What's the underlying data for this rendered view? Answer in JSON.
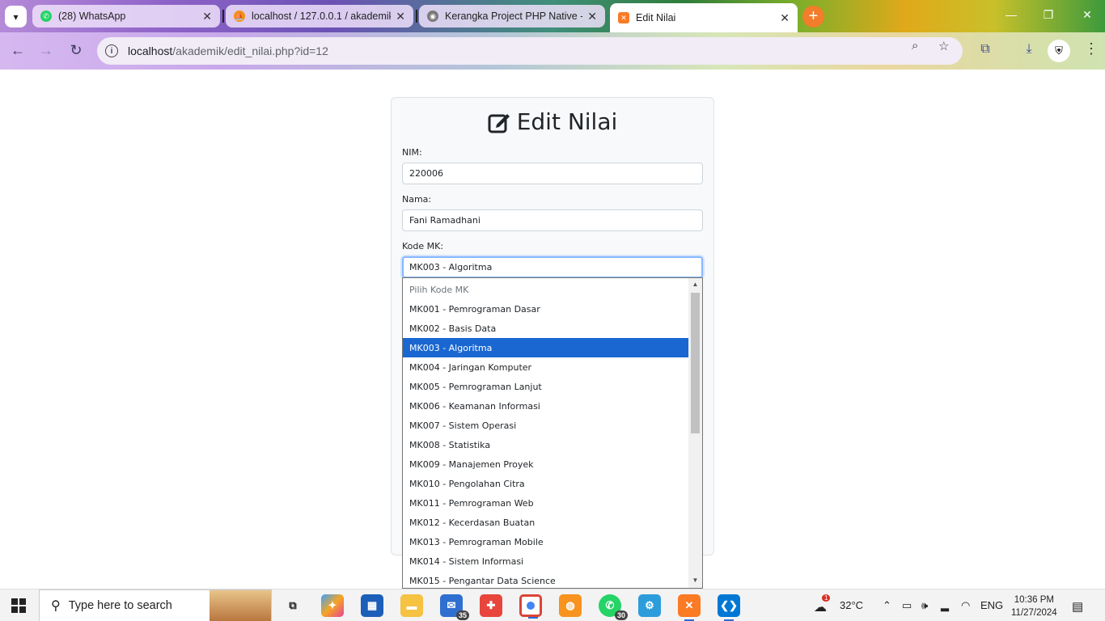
{
  "browser": {
    "tabs": [
      {
        "title": "(28) WhatsApp",
        "icon": "whatsapp-icon",
        "color": "#25d366"
      },
      {
        "title": "localhost / 127.0.0.1 / akademik",
        "icon": "phpmyadmin-icon",
        "color": "#f29111"
      },
      {
        "title": "Kerangka Project PHP Native - ",
        "icon": "chrome-icon",
        "color": "#7a7a7a"
      },
      {
        "title": "Edit Nilai",
        "icon": "xampp-icon",
        "color": "#fb7a24"
      }
    ],
    "url_host": "localhost",
    "url_path": "/akademik/edit_nilai.php?id=12"
  },
  "page": {
    "title": "Edit Nilai",
    "nim_label": "NIM:",
    "nim_value": "220006",
    "nama_label": "Nama:",
    "nama_value": "Fani Ramadhani",
    "kode_mk_label": "Kode MK:",
    "kode_mk_value": "MK003 - Algoritma"
  },
  "dropdown": {
    "placeholder": "Pilih Kode MK",
    "options": [
      "MK001 - Pemrograman Dasar",
      "MK002 - Basis Data",
      "MK003 - Algoritma",
      "MK004 - Jaringan Komputer",
      "MK005 - Pemrograman Lanjut",
      "MK006 - Keamanan Informasi",
      "MK007 - Sistem Operasi",
      "MK008 - Statistika",
      "MK009 - Manajemen Proyek",
      "MK010 - Pengolahan Citra",
      "MK011 - Pemrograman Web",
      "MK012 - Kecerdasan Buatan",
      "MK013 - Pemrograman Mobile",
      "MK014 - Sistem Informasi",
      "MK015 - Pengantar Data Science"
    ],
    "selected": "MK003 - Algoritma"
  },
  "taskbar": {
    "search_placeholder": "Type here to search",
    "mail_badge": "35",
    "whatsapp_badge": "30",
    "weather_badge": "1",
    "temperature": "32°C",
    "language": "ENG",
    "time": "10:36 PM",
    "date": "11/27/2024"
  },
  "colors": {
    "selected_option": "#1a67d2",
    "focus_border": "#86b7fe"
  }
}
